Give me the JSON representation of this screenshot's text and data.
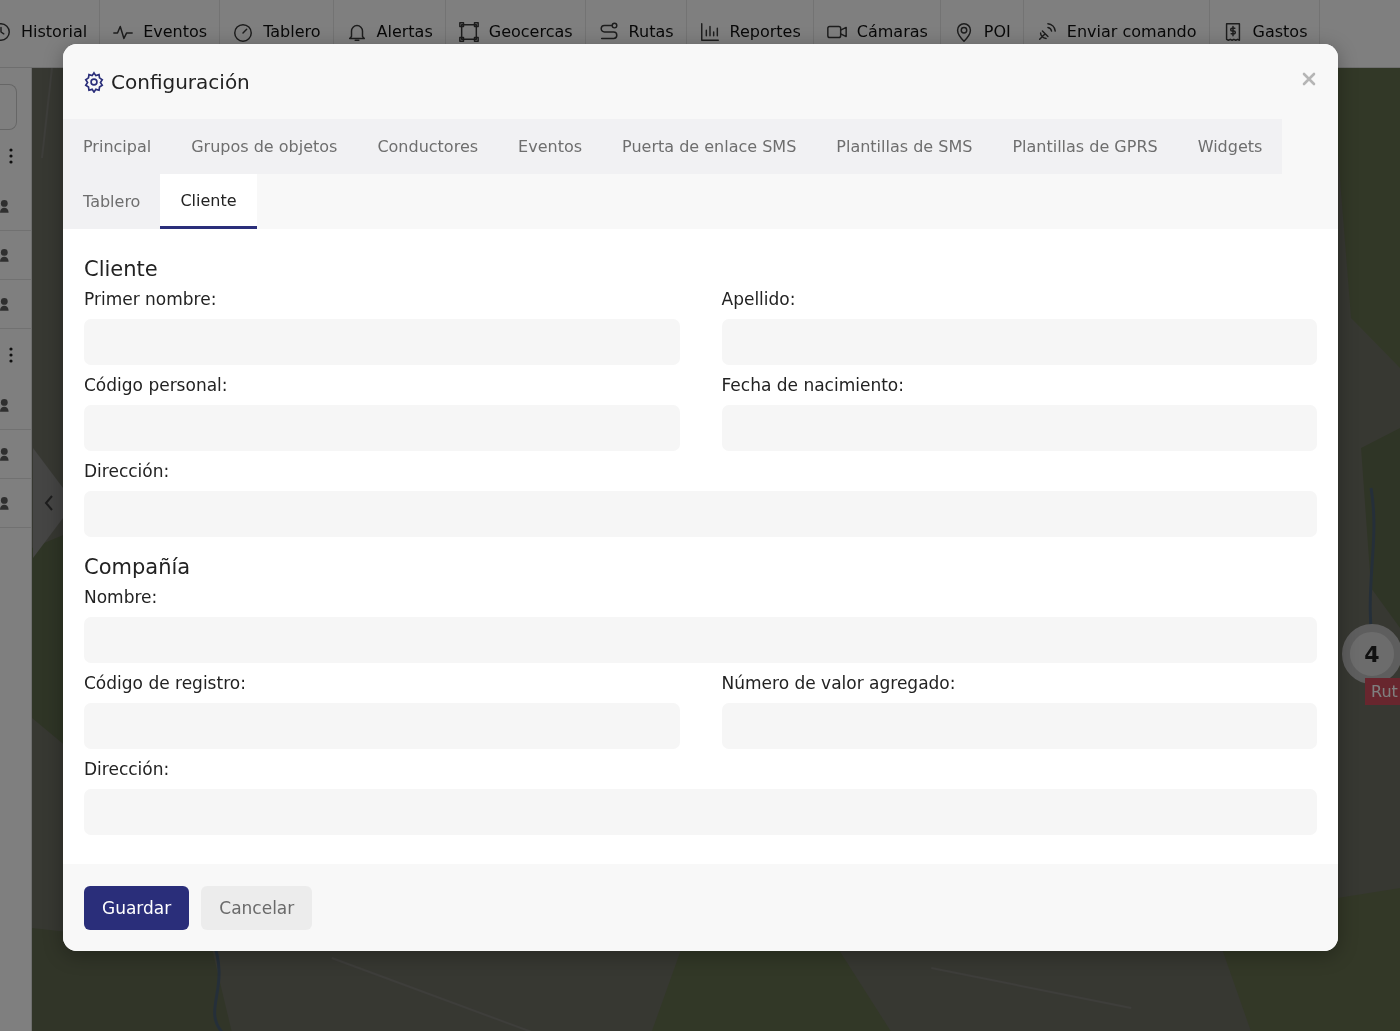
{
  "top_nav": {
    "items": [
      {
        "label": "Historial",
        "kind": "history"
      },
      {
        "label": "Eventos",
        "kind": "pulse"
      },
      {
        "label": "Tablero",
        "kind": "gauge"
      },
      {
        "label": "Alertas",
        "kind": "bell"
      },
      {
        "label": "Geocercas",
        "kind": "shape"
      },
      {
        "label": "Rutas",
        "kind": "route"
      },
      {
        "label": "Reportes",
        "kind": "bars"
      },
      {
        "label": "Cámaras",
        "kind": "camera"
      },
      {
        "label": "POI",
        "kind": "pin"
      },
      {
        "label": "Enviar comando",
        "kind": "signal"
      },
      {
        "label": "Gastos",
        "kind": "receipt"
      }
    ]
  },
  "map": {
    "cluster_count": "4",
    "route_label": "Rut"
  },
  "dialog": {
    "title": "Configuración",
    "tabs": [
      {
        "label": "Principal",
        "selected": false
      },
      {
        "label": "Grupos de objetos",
        "selected": false
      },
      {
        "label": "Conductores",
        "selected": false
      },
      {
        "label": "Eventos",
        "selected": false
      },
      {
        "label": "Puerta de enlace SMS",
        "selected": false
      },
      {
        "label": "Plantillas de SMS",
        "selected": false
      },
      {
        "label": "Plantillas de GPRS",
        "selected": false
      },
      {
        "label": "Widgets",
        "selected": false
      },
      {
        "label": "Tablero",
        "selected": false
      },
      {
        "label": "Cliente",
        "selected": true
      }
    ],
    "sections": [
      {
        "title": "Cliente",
        "fields": [
          {
            "label": "Primer nombre:",
            "kind": "half"
          },
          {
            "label": "Apellido:",
            "kind": "half"
          },
          {
            "label": "Código personal:",
            "kind": "half"
          },
          {
            "label": "Fecha de nacimiento:",
            "kind": "half"
          },
          {
            "label": "Dirección:",
            "kind": "full"
          }
        ]
      },
      {
        "title": "Compañía",
        "fields": [
          {
            "label": "Nombre:",
            "kind": "full"
          },
          {
            "label": "Código de registro:",
            "kind": "half"
          },
          {
            "label": "Número de valor agregado:",
            "kind": "half"
          },
          {
            "label": "Dirección:",
            "kind": "full"
          }
        ]
      }
    ],
    "buttons": [
      {
        "label": "Guardar",
        "kind": "primary"
      },
      {
        "label": "Cancelar",
        "kind": "secondary"
      }
    ]
  }
}
